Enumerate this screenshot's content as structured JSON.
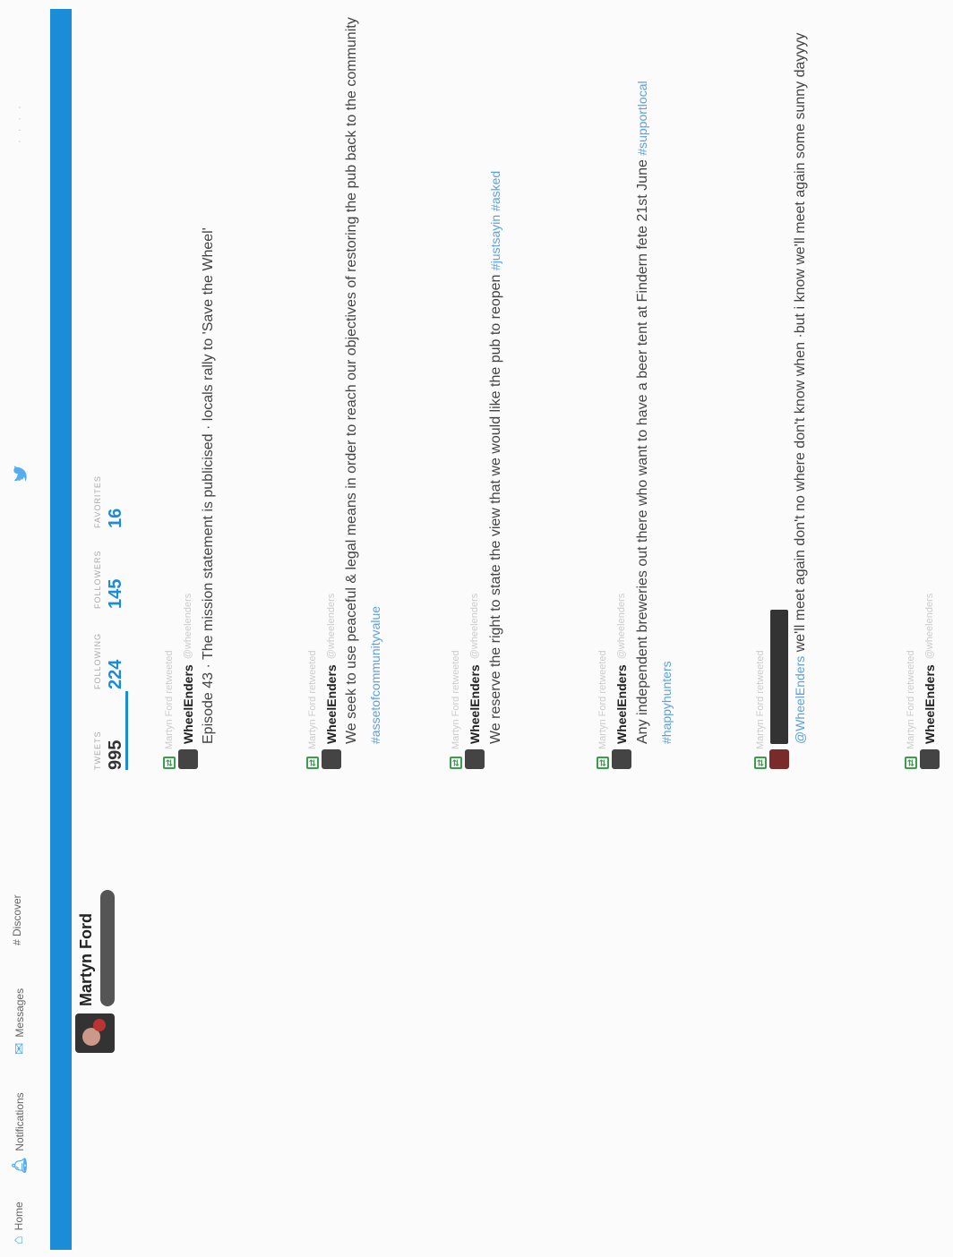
{
  "nav": {
    "home": "Home",
    "notifications": "Notifications",
    "messages": "Messages",
    "discover": "# Discover",
    "right": "· · · ·"
  },
  "profile": {
    "name": "Martyn Ford"
  },
  "stats": [
    {
      "label": "TWEETS",
      "value": "995"
    },
    {
      "label": "FOLLOWING",
      "value": "224"
    },
    {
      "label": "FOLLOWERS",
      "value": "145"
    },
    {
      "label": "FAVORITES",
      "value": "16"
    }
  ],
  "tweets": [
    {
      "retweet": "Martyn Ford retweeted",
      "name": "WheelEnders",
      "meta": "@wheelenders",
      "text": "Episode 43 · The mission statement is publicised · locals rally to 'Save the Wheel'",
      "link": ""
    },
    {
      "retweet": "Martyn Ford retweeted",
      "name": "WheelEnders",
      "meta": "@wheelenders",
      "text": "We seek to use peaceful & legal means in order to reach our objectives of restoring the pub back to the community",
      "link": "#assetofcommunityvalue"
    },
    {
      "retweet": "Martyn Ford retweeted",
      "name": "WheelEnders",
      "meta": "@wheelenders",
      "text": "We reserve the right to state the view that we would like the pub to reopen",
      "link": "#justsayin #asked"
    },
    {
      "retweet": "Martyn Ford retweeted",
      "name": "WheelEnders",
      "meta": "@wheelenders",
      "text": "Any independent breweries out there who want to have a beer tent at Findern fete 21st June",
      "link": "#supportlocal #happyhunters"
    },
    {
      "retweet": "Martyn Ford retweeted",
      "name": "",
      "meta": "",
      "text": "we'll meet again don't no where don't know when ·but i know we'll meet again some sunny dayyyy",
      "link": "@WheelEnders"
    },
    {
      "retweet": "Martyn Ford retweeted",
      "name": "WheelEnders",
      "meta": "@wheelenders",
      "text": "",
      "link": ""
    }
  ],
  "colors": {
    "accent": "#1a8cd8",
    "retweet": "#3c9d4b",
    "link": "#5aa1e0"
  }
}
